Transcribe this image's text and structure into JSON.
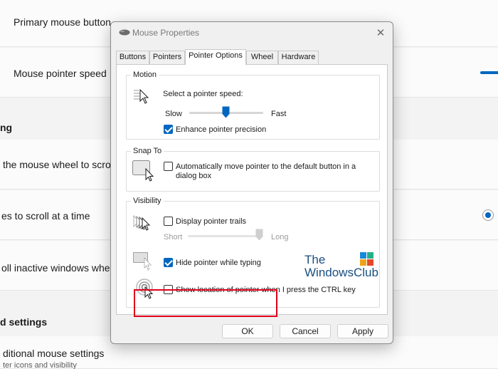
{
  "background": {
    "rows": [
      "Primary mouse button",
      "Mouse pointer speed",
      "the mouse wheel to scro",
      "es to scroll at a time",
      "oll inactive windows when"
    ],
    "headings": [
      "ng",
      "d settings"
    ],
    "additional_title": "ditional mouse settings",
    "additional_sub": "ter icons and visibility"
  },
  "dialog": {
    "title": "Mouse Properties",
    "close_glyph": "✕",
    "tabs": [
      "Buttons",
      "Pointers",
      "Pointer Options",
      "Wheel",
      "Hardware"
    ],
    "active_tab": "Pointer Options",
    "motion": {
      "group": "Motion",
      "select_speed": "Select a pointer speed:",
      "slow": "Slow",
      "fast": "Fast",
      "speed_level": 0.5,
      "enhance_precision": "Enhance pointer precision",
      "enhance_checked": true
    },
    "snap_to": {
      "group": "Snap To",
      "line1": "Automatically move pointer to the default button in a",
      "line2": "dialog box",
      "checked": false
    },
    "visibility": {
      "group": "Visibility",
      "display_trails": "Display pointer trails",
      "trails_checked": false,
      "short": "Short",
      "long": "Long",
      "trails_level": 1.0,
      "hide_while_typing": "Hide pointer while typing",
      "hide_checked": true,
      "show_location": "Show location of pointer when I press the CTRL key",
      "show_checked": false
    },
    "watermark": {
      "line1": "The",
      "line2": "WindowsClub"
    },
    "buttons": {
      "ok": "OK",
      "cancel": "Cancel",
      "apply": "Apply"
    }
  },
  "colors": {
    "accent": "#0067c0",
    "highlight": "#e0001b",
    "watermark": "#1a4f80"
  }
}
